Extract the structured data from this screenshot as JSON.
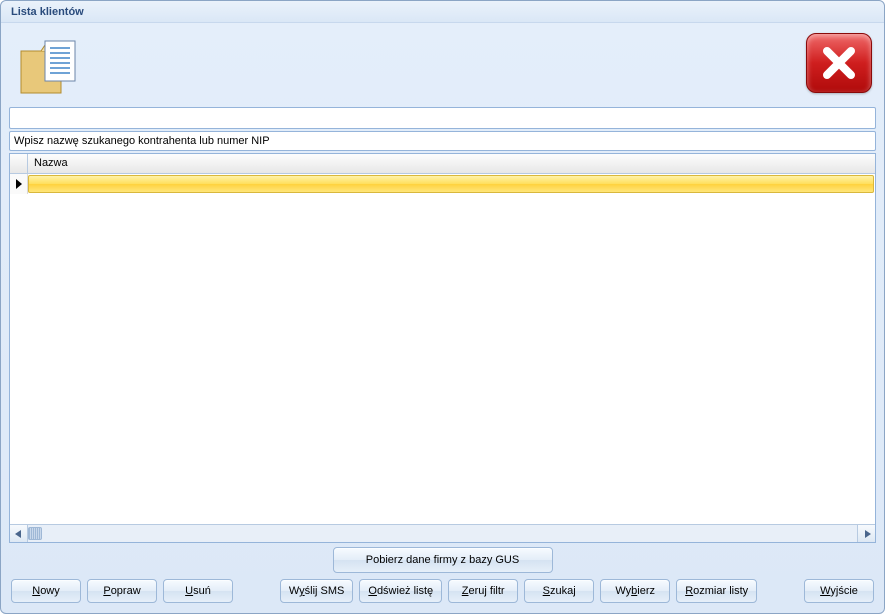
{
  "window": {
    "title": "Lista klientów"
  },
  "search": {
    "placeholder_label": "Wpisz nazwę szukanego kontrahenta lub numer NIP"
  },
  "grid": {
    "columns": [
      "Nazwa"
    ],
    "rows": [
      {
        "nazwa": ""
      }
    ]
  },
  "buttons": {
    "gus": "Pobierz dane firmy z bazy GUS",
    "nowy": {
      "pre": "",
      "u": "N",
      "post": "owy"
    },
    "popraw": {
      "pre": "",
      "u": "P",
      "post": "opraw"
    },
    "usun": {
      "pre": "",
      "u": "U",
      "post": "suń"
    },
    "wyslij_sms": {
      "pre": "W",
      "u": "y",
      "post": "ślij SMS"
    },
    "odswiez": {
      "pre": "",
      "u": "O",
      "post": "dśwież listę"
    },
    "zeruj": {
      "pre": "",
      "u": "Z",
      "post": "eruj filtr"
    },
    "szukaj": {
      "pre": "",
      "u": "S",
      "post": "zukaj"
    },
    "wybierz": {
      "pre": "Wy",
      "u": "b",
      "post": "ierz"
    },
    "rozmiar": {
      "pre": "",
      "u": "R",
      "post": "ozmiar listy"
    },
    "wyjscie": {
      "pre": "",
      "u": "W",
      "post": "yjście"
    }
  }
}
